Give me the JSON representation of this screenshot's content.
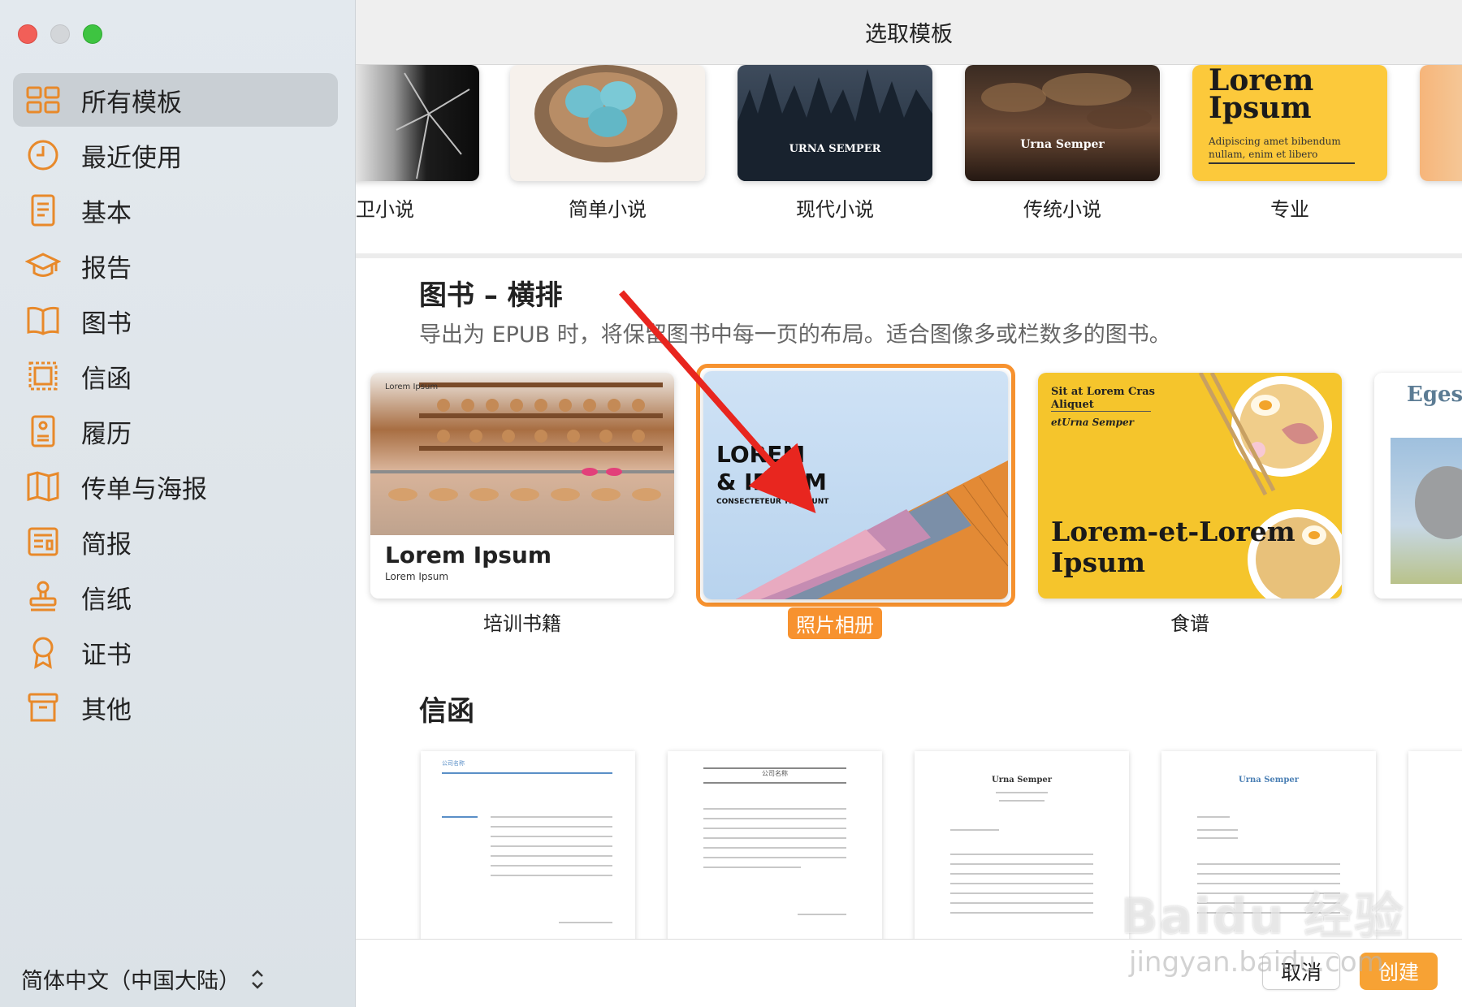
{
  "window": {
    "title": "选取模板"
  },
  "sidebar": {
    "items": [
      {
        "label": "所有模板",
        "icon": "grid-icon",
        "active": true
      },
      {
        "label": "最近使用",
        "icon": "clock-icon",
        "active": false
      },
      {
        "label": "基本",
        "icon": "document-icon",
        "active": false
      },
      {
        "label": "报告",
        "icon": "graduation-cap-icon",
        "active": false
      },
      {
        "label": "图书",
        "icon": "book-icon",
        "active": false
      },
      {
        "label": "信函",
        "icon": "stamp-frame-icon",
        "active": false
      },
      {
        "label": "履历",
        "icon": "resume-icon",
        "active": false
      },
      {
        "label": "传单与海报",
        "icon": "map-fold-icon",
        "active": false
      },
      {
        "label": "简报",
        "icon": "newsletter-icon",
        "active": false
      },
      {
        "label": "信纸",
        "icon": "stamp-icon",
        "active": false
      },
      {
        "label": "证书",
        "icon": "ribbon-award-icon",
        "active": false
      },
      {
        "label": "其他",
        "icon": "archive-box-icon",
        "active": false
      }
    ],
    "language": "简体中文（中国大陆）"
  },
  "top_row": {
    "items": [
      {
        "label": "卫小说"
      },
      {
        "label": "简单小说"
      },
      {
        "label": "现代小说",
        "cover_text": "URNA SEMPER"
      },
      {
        "label": "传统小说",
        "cover_text": "Urna Semper"
      },
      {
        "label": "专业",
        "cover_title": "Lorem Ipsum",
        "cover_sub": "Adipiscing amet bibendum nullam, enim et libero"
      }
    ]
  },
  "books_landscape": {
    "title": "图书 – 横排",
    "description": "导出为 EPUB 时，将保留图书中每一页的布局。适合图像多或栏数多的图书。",
    "items": [
      {
        "label": "培训书籍",
        "cover_small": "Lorem Ipsum",
        "cover_title": "Lorem Ipsum",
        "cover_sub": "Lorem Ipsum"
      },
      {
        "label": "照片相册",
        "selected": true,
        "cover_title_1": "LOREM",
        "cover_title_2": "& IPSUM",
        "cover_sub": "CONSECTETEUR TINCIDUNT"
      },
      {
        "label": "食谱",
        "cover_top_1": "Sit at Lorem Cras",
        "cover_top_2": "Aliquet",
        "cover_top_3": "etUrna Semper",
        "cover_title_1": "Lorem-et-Lorem",
        "cover_title_2": "Ipsum"
      },
      {
        "label": "",
        "cover_title": "Eges"
      }
    ]
  },
  "letters": {
    "title": "信函",
    "items": [
      {
        "header": "公司名称"
      },
      {
        "header": "公司名称"
      },
      {
        "header": "Urna Semper"
      },
      {
        "header": "Urna Semper"
      }
    ]
  },
  "footer": {
    "cancel_label": "取消",
    "create_label": "创建"
  },
  "watermark": {
    "text": "Baidu 经验",
    "sub": "jingyan.baidu.com"
  },
  "colors": {
    "accent": "#f7922f",
    "sidebar_icon": "#e8892a"
  }
}
